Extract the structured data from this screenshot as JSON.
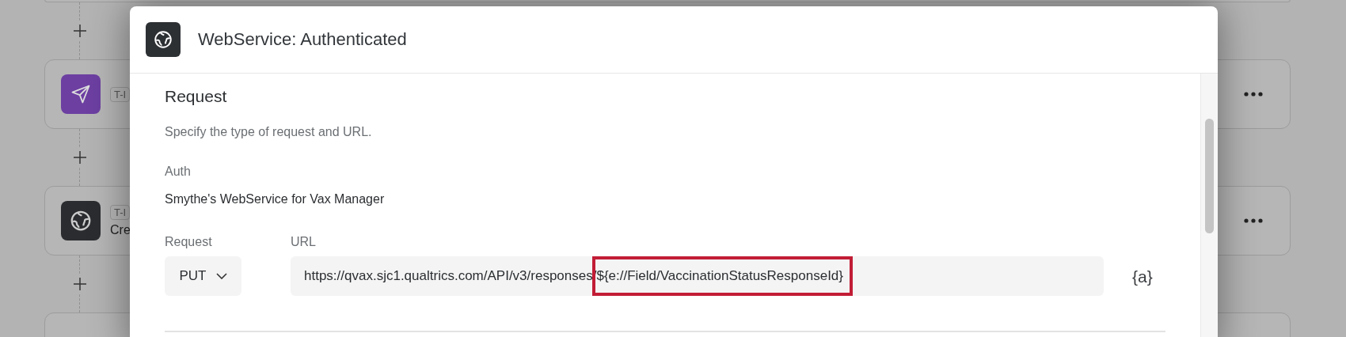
{
  "flow": {
    "steps": [
      {
        "kind": "cut"
      },
      {
        "kind": "send",
        "tag": "T-I"
      },
      {
        "kind": "web",
        "tag": "T-I",
        "label": "Cre"
      },
      {
        "kind": "empty"
      }
    ]
  },
  "dialog": {
    "title": "WebService: Authenticated",
    "section": {
      "heading": "Request",
      "description": "Specify the type of request and URL."
    },
    "auth": {
      "label": "Auth",
      "value": "Smythe's WebService for Vax Manager"
    },
    "request": {
      "label": "Request",
      "value": "PUT"
    },
    "url": {
      "label": "URL",
      "value": "https://qvax.sjc1.qualtrics.com/API/v3/responses/",
      "highlighted": "${e://Field/VaccinationStatusResponseId}"
    },
    "piped_text_button": "{a}"
  }
}
